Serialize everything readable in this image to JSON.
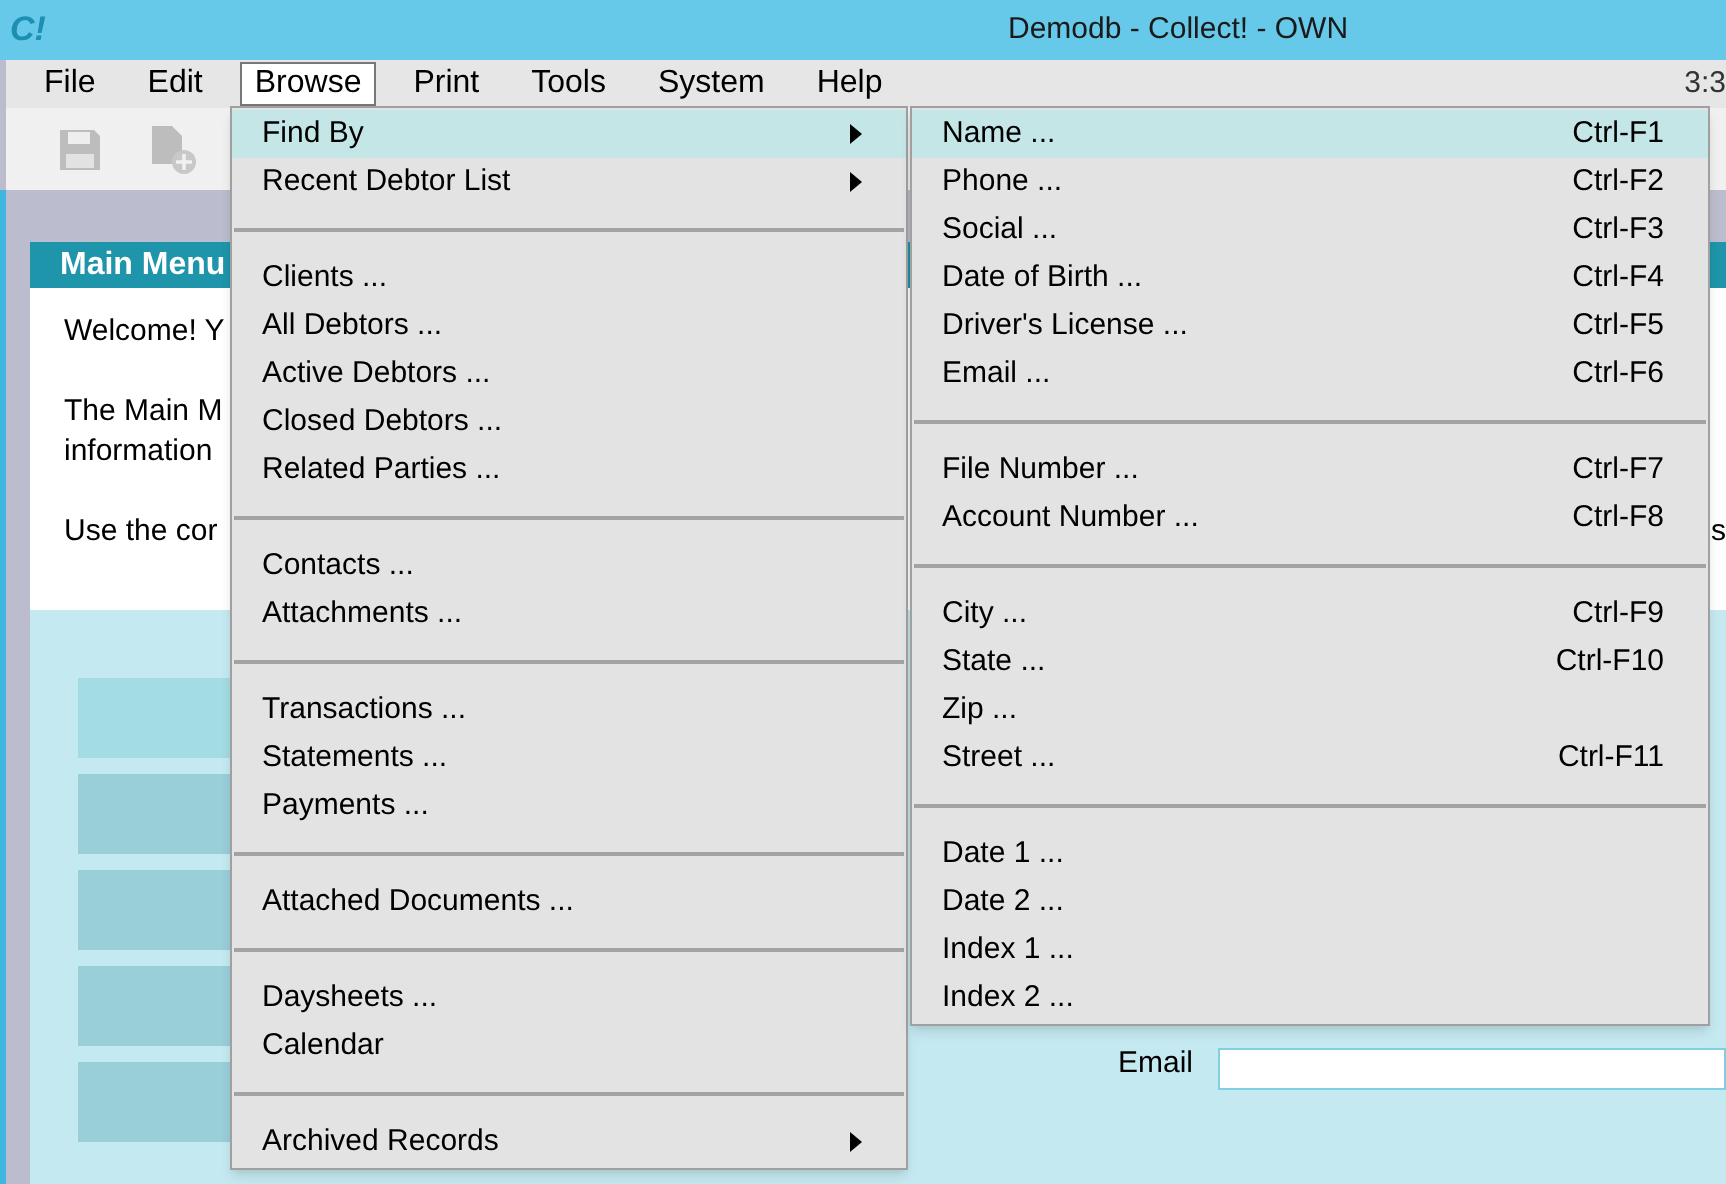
{
  "window": {
    "title": "Demodb - Collect! - OWN",
    "logo": "C!"
  },
  "menu_bar": [
    {
      "label": "File",
      "selected": false
    },
    {
      "label": "Edit",
      "selected": false
    },
    {
      "label": "Browse",
      "selected": true
    },
    {
      "label": "Print",
      "selected": false
    },
    {
      "label": "Tools",
      "selected": false
    },
    {
      "label": "System",
      "selected": false
    },
    {
      "label": "Help",
      "selected": false
    }
  ],
  "clock": "3:3",
  "main_menu": {
    "title": "Main Menu",
    "lines": [
      "Welcome! Y",
      "The Main M",
      "information",
      "Use the cor"
    ],
    "right_fragments": [
      "s"
    ]
  },
  "form": {
    "email_label": "Email"
  },
  "browse_menu": [
    [
      {
        "label": "Find By",
        "has_submenu": true,
        "selected": true
      },
      {
        "label": "Recent Debtor List",
        "has_submenu": true,
        "selected": false
      }
    ],
    [
      {
        "label": "Clients ...",
        "has_submenu": false,
        "selected": false
      },
      {
        "label": "All Debtors ...",
        "has_submenu": false,
        "selected": false
      },
      {
        "label": "Active Debtors ...",
        "has_submenu": false,
        "selected": false
      },
      {
        "label": "Closed Debtors ...",
        "has_submenu": false,
        "selected": false
      },
      {
        "label": "Related Parties ...",
        "has_submenu": false,
        "selected": false
      }
    ],
    [
      {
        "label": "Contacts ...",
        "has_submenu": false,
        "selected": false
      },
      {
        "label": "Attachments ...",
        "has_submenu": false,
        "selected": false
      }
    ],
    [
      {
        "label": "Transactions ...",
        "has_submenu": false,
        "selected": false
      },
      {
        "label": "Statements ...",
        "has_submenu": false,
        "selected": false
      },
      {
        "label": "Payments ...",
        "has_submenu": false,
        "selected": false
      }
    ],
    [
      {
        "label": "Attached Documents ...",
        "has_submenu": false,
        "selected": false
      }
    ],
    [
      {
        "label": "Daysheets ...",
        "has_submenu": false,
        "selected": false
      },
      {
        "label": "Calendar",
        "has_submenu": false,
        "selected": false
      }
    ],
    [
      {
        "label": "Archived Records",
        "has_submenu": true,
        "selected": false
      }
    ]
  ],
  "find_by_menu": [
    [
      {
        "label": "Name ...",
        "shortcut": "Ctrl-F1",
        "selected": true
      },
      {
        "label": "Phone ...",
        "shortcut": "Ctrl-F2",
        "selected": false
      },
      {
        "label": "Social ...",
        "shortcut": "Ctrl-F3",
        "selected": false
      },
      {
        "label": "Date of Birth ...",
        "shortcut": "Ctrl-F4",
        "selected": false
      },
      {
        "label": "Driver's License ...",
        "shortcut": "Ctrl-F5",
        "selected": false
      },
      {
        "label": "Email ...",
        "shortcut": "Ctrl-F6",
        "selected": false
      }
    ],
    [
      {
        "label": "File Number ...",
        "shortcut": "Ctrl-F7",
        "selected": false
      },
      {
        "label": "Account Number ...",
        "shortcut": "Ctrl-F8",
        "selected": false
      }
    ],
    [
      {
        "label": "City ...",
        "shortcut": "Ctrl-F9",
        "selected": false
      },
      {
        "label": "State ...",
        "shortcut": "Ctrl-F10",
        "selected": false
      },
      {
        "label": "Zip ...",
        "selected": false
      },
      {
        "label": "Street ...",
        "shortcut": "Ctrl-F11",
        "selected": false
      }
    ],
    [
      {
        "label": "Date 1 ...",
        "selected": false
      },
      {
        "label": "Date 2 ...",
        "selected": false
      },
      {
        "label": "Index 1 ...",
        "selected": false
      },
      {
        "label": "Index 2 ...",
        "selected": false
      }
    ]
  ]
}
